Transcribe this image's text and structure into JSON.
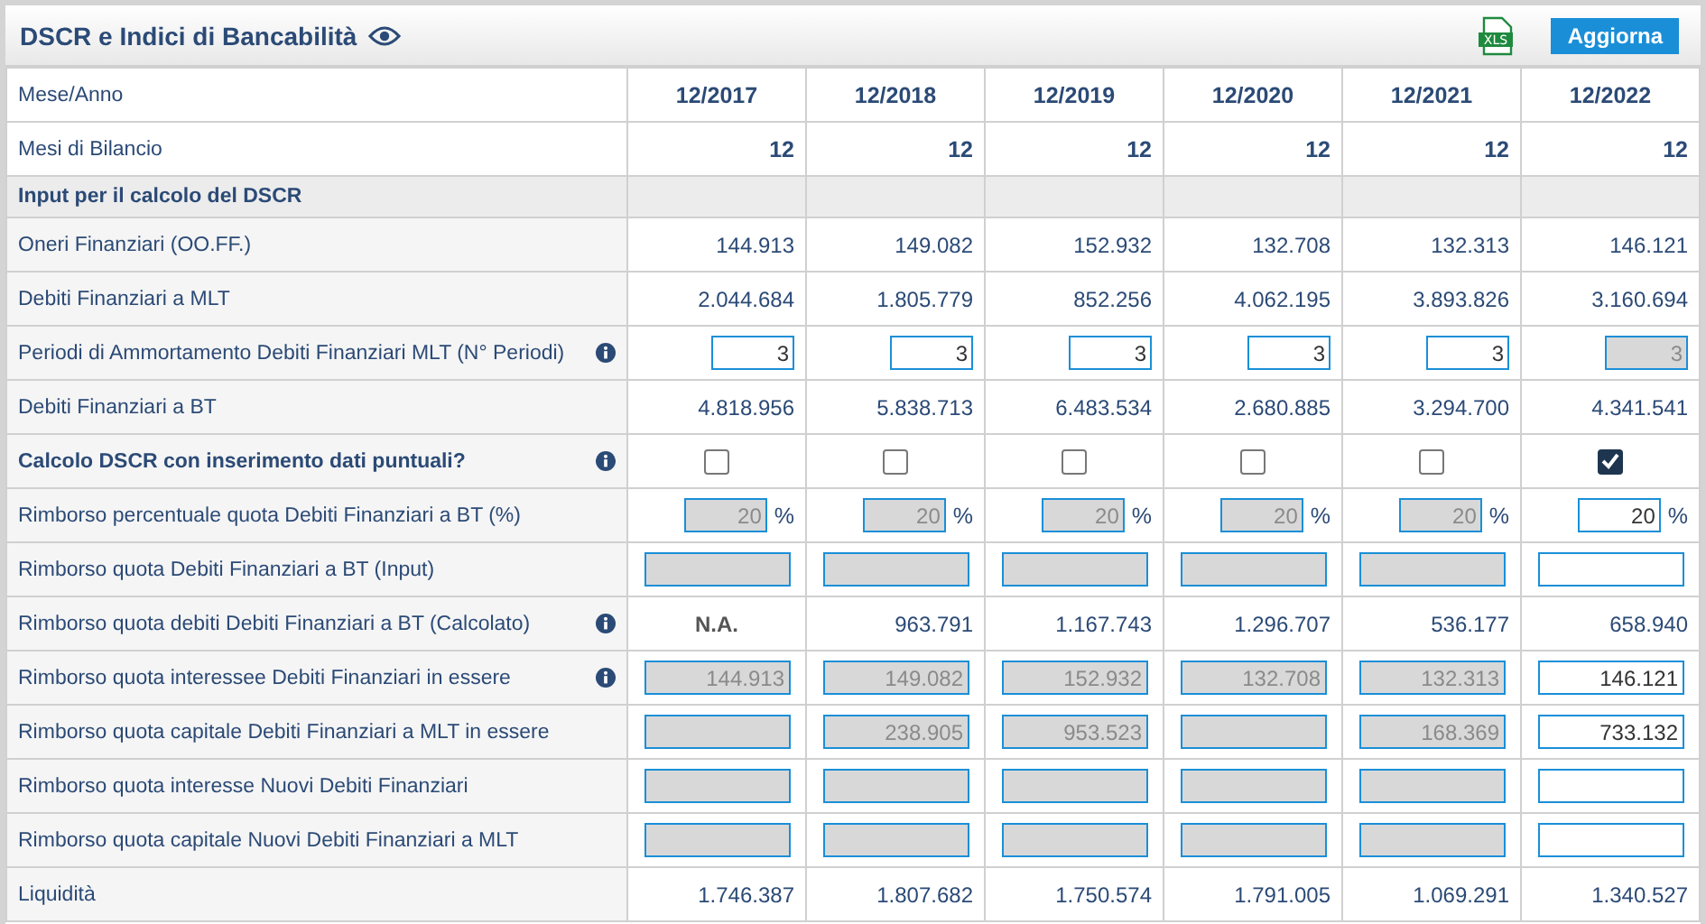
{
  "panel": {
    "title": "DSCR e Indici di Bancabilità",
    "export_label": "XLS",
    "refresh_button": "Aggiorna"
  },
  "table": {
    "rows": [
      {
        "kind": "header",
        "label": "Mese/Anno",
        "info": false,
        "cells": [
          "12/2017",
          "12/2018",
          "12/2019",
          "12/2020",
          "12/2021",
          "12/2022"
        ]
      },
      {
        "kind": "header_right",
        "label": "Mesi di Bilancio",
        "info": false,
        "cells": [
          "12",
          "12",
          "12",
          "12",
          "12",
          "12"
        ]
      },
      {
        "kind": "section",
        "label": "Input per il calcolo del DSCR",
        "info": false
      },
      {
        "kind": "value",
        "label": "Oneri Finanziari (OO.FF.)",
        "info": false,
        "cells": [
          {
            "text": "144.913",
            "unavailable": false
          },
          {
            "text": "149.082",
            "unavailable": false
          },
          {
            "text": "152.932",
            "unavailable": false
          },
          {
            "text": "132.708",
            "unavailable": false
          },
          {
            "text": "132.313",
            "unavailable": false
          },
          {
            "text": "146.121",
            "unavailable": false
          }
        ]
      },
      {
        "kind": "value",
        "label": "Debiti Finanziari a MLT",
        "info": false,
        "cells": [
          {
            "text": "2.044.684",
            "unavailable": false
          },
          {
            "text": "1.805.779",
            "unavailable": false
          },
          {
            "text": "852.256",
            "unavailable": false
          },
          {
            "text": "4.062.195",
            "unavailable": false
          },
          {
            "text": "3.893.826",
            "unavailable": false
          },
          {
            "text": "3.160.694",
            "unavailable": false
          }
        ]
      },
      {
        "kind": "small_input",
        "label": "Periodi di Ammortamento Debiti Finanziari MLT (N° Periodi)",
        "info": true,
        "cells": [
          {
            "value": "3",
            "disabled": false
          },
          {
            "value": "3",
            "disabled": false
          },
          {
            "value": "3",
            "disabled": false
          },
          {
            "value": "3",
            "disabled": false
          },
          {
            "value": "3",
            "disabled": false
          },
          {
            "value": "3",
            "disabled": true
          }
        ]
      },
      {
        "kind": "value",
        "label": "Debiti Finanziari a BT",
        "info": false,
        "cells": [
          {
            "text": "4.818.956",
            "unavailable": false
          },
          {
            "text": "5.838.713",
            "unavailable": false
          },
          {
            "text": "6.483.534",
            "unavailable": false
          },
          {
            "text": "2.680.885",
            "unavailable": false
          },
          {
            "text": "3.294.700",
            "unavailable": false
          },
          {
            "text": "4.341.541",
            "unavailable": false
          }
        ]
      },
      {
        "kind": "checkbox",
        "label": "Calcolo DSCR con inserimento dati puntuali?",
        "info": true,
        "cells": [
          {
            "checked": false
          },
          {
            "checked": false
          },
          {
            "checked": false
          },
          {
            "checked": false
          },
          {
            "checked": false
          },
          {
            "checked": true
          }
        ]
      },
      {
        "kind": "percent",
        "label": "Rimborso percentuale quota Debiti Finanziari a BT (%)",
        "info": false,
        "cells": [
          {
            "value": "20",
            "unit": "%",
            "disabled": true
          },
          {
            "value": "20",
            "unit": "%",
            "disabled": true
          },
          {
            "value": "20",
            "unit": "%",
            "disabled": true
          },
          {
            "value": "20",
            "unit": "%",
            "disabled": true
          },
          {
            "value": "20",
            "unit": "%",
            "disabled": true
          },
          {
            "value": "20",
            "unit": "%",
            "disabled": false
          }
        ]
      },
      {
        "kind": "input",
        "label": "Rimborso quota Debiti Finanziari a BT (Input)",
        "info": false,
        "cells": [
          {
            "disabled": true
          },
          {
            "disabled": true
          },
          {
            "disabled": true
          },
          {
            "disabled": true
          },
          {
            "disabled": true
          },
          {
            "disabled": false
          }
        ]
      },
      {
        "kind": "value",
        "label": "Rimborso quota debiti Debiti Finanziari a BT (Calcolato)",
        "info": true,
        "cells": [
          {
            "text": "N.A.",
            "unavailable": true
          },
          {
            "text": "963.791",
            "unavailable": false
          },
          {
            "text": "1.167.743",
            "unavailable": false
          },
          {
            "text": "1.296.707",
            "unavailable": false
          },
          {
            "text": "536.177",
            "unavailable": false
          },
          {
            "text": "658.940",
            "unavailable": false
          }
        ]
      },
      {
        "kind": "input",
        "label": "Rimborso quota interessee Debiti Finanziari in essere",
        "info": true,
        "cells": [
          {
            "value": "144.913",
            "disabled": true
          },
          {
            "value": "149.082",
            "disabled": true
          },
          {
            "value": "152.932",
            "disabled": true
          },
          {
            "value": "132.708",
            "disabled": true
          },
          {
            "value": "132.313",
            "disabled": true
          },
          {
            "value": "146.121",
            "disabled": false
          }
        ]
      },
      {
        "kind": "input",
        "label": "Rimborso quota capitale Debiti Finanziari a MLT in essere",
        "info": false,
        "cells": [
          {
            "disabled": true
          },
          {
            "value": "238.905",
            "disabled": true
          },
          {
            "value": "953.523",
            "disabled": true
          },
          {
            "disabled": true
          },
          {
            "value": "168.369",
            "disabled": true
          },
          {
            "value": "733.132",
            "disabled": false
          }
        ]
      },
      {
        "kind": "input",
        "label": "Rimborso quota interesse Nuovi Debiti Finanziari",
        "info": false,
        "cells": [
          {
            "disabled": true
          },
          {
            "disabled": true
          },
          {
            "disabled": true
          },
          {
            "disabled": true
          },
          {
            "disabled": true
          },
          {
            "disabled": false
          }
        ]
      },
      {
        "kind": "input",
        "label": "Rimborso quota capitale Nuovi Debiti Finanziari a MLT",
        "info": false,
        "cells": [
          {
            "disabled": true
          },
          {
            "disabled": true
          },
          {
            "disabled": true
          },
          {
            "disabled": true
          },
          {
            "disabled": true
          },
          {
            "disabled": false
          }
        ]
      },
      {
        "kind": "value",
        "label": "Liquidità",
        "info": false,
        "cells": [
          {
            "text": "1.746.387",
            "unavailable": false
          },
          {
            "text": "1.807.682",
            "unavailable": false
          },
          {
            "text": "1.750.574",
            "unavailable": false
          },
          {
            "text": "1.791.005",
            "unavailable": false
          },
          {
            "text": "1.069.291",
            "unavailable": false
          },
          {
            "text": "1.340.527",
            "unavailable": false
          }
        ]
      }
    ]
  }
}
